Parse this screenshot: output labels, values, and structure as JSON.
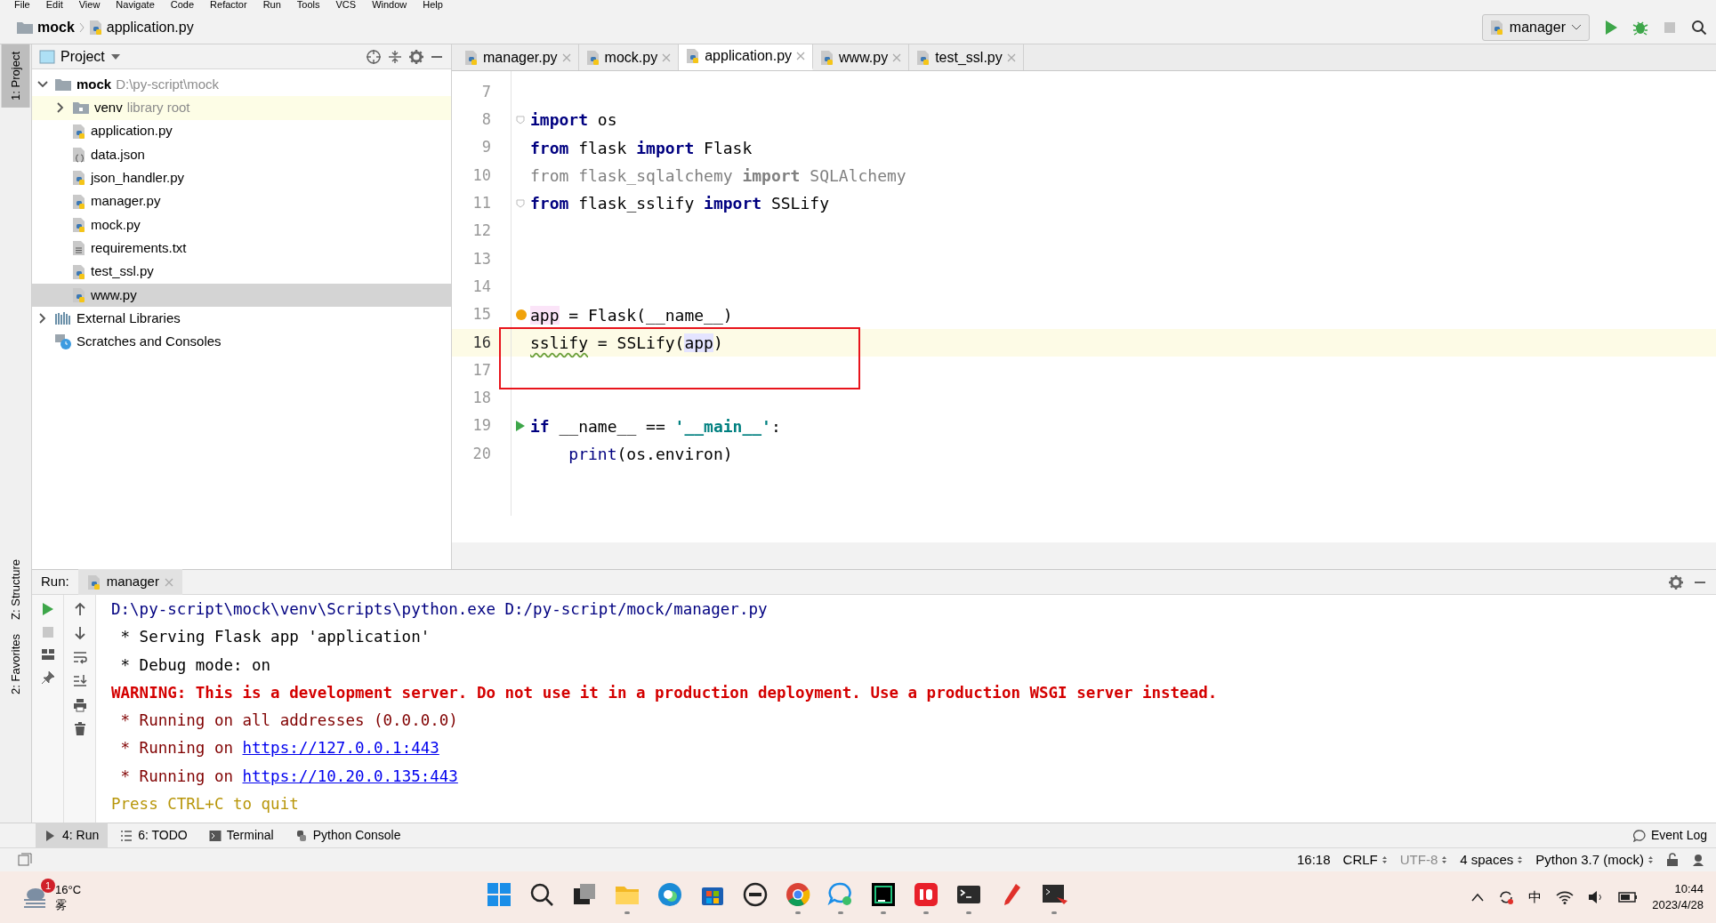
{
  "menu": [
    "File",
    "Edit",
    "View",
    "Navigate",
    "Code",
    "Refactor",
    "Run",
    "Tools",
    "VCS",
    "Window",
    "Help"
  ],
  "breadcrumb": [
    {
      "label": "mock",
      "kind": "folder"
    },
    {
      "label": "application.py",
      "kind": "python"
    }
  ],
  "run_config": {
    "label": "manager"
  },
  "side_tabs": [
    {
      "label": "1: Project",
      "selected": true,
      "kind": "top"
    },
    {
      "label": "Z: Structure",
      "selected": false,
      "kind": "bottom"
    },
    {
      "label": "2: Favorites",
      "selected": false,
      "kind": "bottom"
    }
  ],
  "project_panel": {
    "title": "Project",
    "tree": [
      {
        "label": "mock",
        "hint": "D:\\py-script\\mock",
        "kind": "folder",
        "expanded": true,
        "selected": false,
        "children": [
          {
            "label": "venv",
            "hint": "library root",
            "kind": "library-folder",
            "expanded": false,
            "selected": false
          },
          {
            "label": "application.py",
            "kind": "python",
            "selected": false
          },
          {
            "label": "data.json",
            "kind": "json",
            "selected": false
          },
          {
            "label": "json_handler.py",
            "kind": "python",
            "selected": false
          },
          {
            "label": "manager.py",
            "kind": "python",
            "selected": false
          },
          {
            "label": "mock.py",
            "kind": "python",
            "selected": false
          },
          {
            "label": "requirements.txt",
            "kind": "text",
            "selected": false
          },
          {
            "label": "test_ssl.py",
            "kind": "python",
            "selected": false
          },
          {
            "label": "www.py",
            "kind": "python",
            "selected": true
          }
        ]
      },
      {
        "label": "External Libraries",
        "kind": "libraries",
        "expanded": false,
        "selected": false
      },
      {
        "label": "Scratches and Consoles",
        "kind": "scratches",
        "selected": false
      }
    ]
  },
  "editor_tabs": [
    {
      "label": "manager.py",
      "selected": false
    },
    {
      "label": "mock.py",
      "selected": false
    },
    {
      "label": "application.py",
      "selected": true
    },
    {
      "label": "www.py",
      "selected": false
    },
    {
      "label": "test_ssl.py",
      "selected": false
    }
  ],
  "editor": {
    "annotation_box": {
      "color": "#e8141c"
    },
    "lines": [
      {
        "number": "7",
        "current": false,
        "kind": "blank"
      },
      {
        "number": "8",
        "current": false,
        "kind": "fold",
        "tokens": [
          {
            "text": "import",
            "kind": "keyword"
          },
          {
            "text": " os",
            "kind": "plain"
          }
        ]
      },
      {
        "number": "9",
        "current": false,
        "kind": "code",
        "tokens": [
          {
            "text": "from",
            "kind": "keyword"
          },
          {
            "text": " flask ",
            "kind": "plain"
          },
          {
            "text": "import",
            "kind": "keyword"
          },
          {
            "text": " Flask",
            "kind": "plain"
          }
        ]
      },
      {
        "number": "10",
        "current": false,
        "kind": "code",
        "tokens": [
          {
            "text": "from flask_sqlalchemy ",
            "kind": "unused"
          },
          {
            "text": "import",
            "kind": "unused-keyword"
          },
          {
            "text": " SQLAlchemy",
            "kind": "unused"
          }
        ]
      },
      {
        "number": "11",
        "current": false,
        "kind": "fold",
        "tokens": [
          {
            "text": "from",
            "kind": "keyword"
          },
          {
            "text": " flask_sslify ",
            "kind": "plain"
          },
          {
            "text": "import",
            "kind": "keyword"
          },
          {
            "text": " SSLify",
            "kind": "plain"
          }
        ]
      },
      {
        "number": "12",
        "current": false,
        "kind": "blank"
      },
      {
        "number": "13",
        "current": false,
        "kind": "blank"
      },
      {
        "number": "14",
        "current": false,
        "kind": "blank"
      },
      {
        "number": "15",
        "current": false,
        "kind": "code",
        "bulb": true,
        "tokens": [
          {
            "text": "app",
            "kind": "marked"
          },
          {
            "text": " = Flask(__name__)",
            "kind": "plain"
          }
        ]
      },
      {
        "number": "16",
        "current": true,
        "kind": "code",
        "tokens": [
          {
            "text": "sslify",
            "kind": "typo"
          },
          {
            "text": " = SSLify(",
            "kind": "plain"
          },
          {
            "text": "app",
            "kind": "usage"
          },
          {
            "text": ")",
            "kind": "plain"
          }
        ]
      },
      {
        "number": "17",
        "current": false,
        "kind": "blank"
      },
      {
        "number": "18",
        "current": false,
        "kind": "blank"
      },
      {
        "number": "19",
        "current": false,
        "kind": "run",
        "tokens": [
          {
            "text": "if",
            "kind": "keyword"
          },
          {
            "text": " __name__ == ",
            "kind": "plain"
          },
          {
            "text": "'__main__'",
            "kind": "string"
          },
          {
            "text": ":",
            "kind": "plain"
          }
        ]
      },
      {
        "number": "20",
        "current": false,
        "kind": "indented",
        "tokens": [
          {
            "text": "print",
            "kind": "builtin"
          },
          {
            "text": "(os.environ)",
            "kind": "plain"
          }
        ]
      }
    ]
  },
  "run_panel": {
    "label": "Run:",
    "tab": "manager",
    "console": [
      [
        {
          "text": "D:\\py-script\\mock\\venv\\Scripts\\python.exe D:/py-script/mock/manager.py",
          "kind": "command"
        }
      ],
      [
        {
          "text": " * Serving Flask app 'application'",
          "kind": "stdout"
        }
      ],
      [
        {
          "text": " * Debug mode: on",
          "kind": "stdout"
        }
      ],
      [
        {
          "text": "WARNING: This is a development server. Do not use it in a production deployment. Use a production WSGI server instead.",
          "kind": "warning"
        }
      ],
      [
        {
          "text": " * Running on all addresses (0.0.0.0)",
          "kind": "info"
        }
      ],
      [
        {
          "text": " * Running on ",
          "kind": "info"
        },
        {
          "text": "https://127.0.0.1:443",
          "kind": "link"
        }
      ],
      [
        {
          "text": " * Running on ",
          "kind": "info"
        },
        {
          "text": "https://10.20.0.135:443",
          "kind": "link"
        }
      ],
      [
        {
          "text": "Press CTRL+C to quit",
          "kind": "hint"
        }
      ]
    ]
  },
  "tool_tabs": [
    {
      "label": "4: Run",
      "kind": "run",
      "selected": true
    },
    {
      "label": "6: TODO",
      "kind": "todo",
      "selected": false
    },
    {
      "label": "Terminal",
      "kind": "terminal",
      "selected": false
    },
    {
      "label": "Python Console",
      "kind": "console",
      "selected": false
    }
  ],
  "event_log": "Event Log",
  "status_bar": [
    {
      "text": "16:18",
      "dropdown": false,
      "disabled": false
    },
    {
      "text": "CRLF",
      "dropdown": true,
      "disabled": false
    },
    {
      "text": "UTF-8",
      "dropdown": true,
      "disabled": true
    },
    {
      "text": "4 spaces",
      "dropdown": true,
      "disabled": false
    },
    {
      "text": "Python 3.7 (mock)",
      "dropdown": true,
      "disabled": false
    }
  ],
  "taskbar": {
    "weather": {
      "temperature": "16°C",
      "condition": "雾",
      "badge": "1"
    },
    "apps": [
      {
        "kind": "windows",
        "running": false
      },
      {
        "kind": "search",
        "running": false
      },
      {
        "kind": "taskview",
        "running": false
      },
      {
        "kind": "files",
        "running": true
      },
      {
        "kind": "edge",
        "running": false
      },
      {
        "kind": "store",
        "running": false
      },
      {
        "kind": "dell",
        "running": false
      },
      {
        "kind": "chrome",
        "running": true
      },
      {
        "kind": "chat",
        "running": true
      },
      {
        "kind": "pycharm",
        "running": true
      },
      {
        "kind": "youdao",
        "running": true
      },
      {
        "kind": "terminal",
        "running": true
      },
      {
        "kind": "pen",
        "running": false
      },
      {
        "kind": "shell",
        "running": true
      }
    ],
    "ime": "中",
    "time": "10:44",
    "date": "2023/4/28"
  }
}
